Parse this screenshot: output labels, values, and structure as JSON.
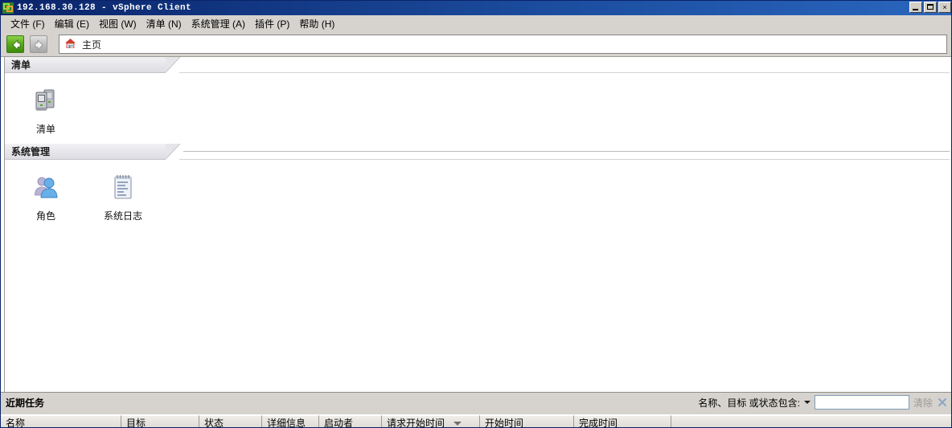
{
  "window": {
    "title": "192.168.30.128 - vSphere Client",
    "app_icon": "vsphere-app-icon",
    "minimize_label": "",
    "maximize_label": "",
    "close_label": "×"
  },
  "menubar": {
    "items": [
      {
        "label": "文件 (F)",
        "name": "menu-file"
      },
      {
        "label": "编辑 (E)",
        "name": "menu-edit"
      },
      {
        "label": "视图 (W)",
        "name": "menu-view"
      },
      {
        "label": "清单 (N)",
        "name": "menu-inventory"
      },
      {
        "label": "系统管理 (A)",
        "name": "menu-administration"
      },
      {
        "label": "插件 (P)",
        "name": "menu-plugins"
      },
      {
        "label": "帮助 (H)",
        "name": "menu-help"
      }
    ]
  },
  "navbar": {
    "back_icon": "back-arrow-icon",
    "forward_icon": "forward-arrow-icon",
    "home_icon": "home-icon",
    "breadcrumb": "主页"
  },
  "sections": [
    {
      "title": "清单",
      "name": "section-inventory",
      "tiles": [
        {
          "label": "清单",
          "icon": "servers-icon",
          "name": "tile-inventory"
        }
      ]
    },
    {
      "title": "系统管理",
      "name": "section-administration",
      "tiles": [
        {
          "label": "角色",
          "icon": "users-icon",
          "name": "tile-roles"
        },
        {
          "label": "系统日志",
          "icon": "notepad-icon",
          "name": "tile-system-logs"
        }
      ]
    }
  ],
  "tasks": {
    "title": "近期任务",
    "filter_label": "名称、目标 或状态包含:",
    "filter_value": "",
    "filter_placeholder": "",
    "clear_label": "清除",
    "close_icon": "close-x-icon",
    "columns": [
      {
        "label": "名称",
        "width": 150,
        "sorted": false
      },
      {
        "label": "目标",
        "width": 97,
        "sorted": false
      },
      {
        "label": "状态",
        "width": 78,
        "sorted": false
      },
      {
        "label": "详细信息",
        "width": 71,
        "sorted": false
      },
      {
        "label": "启动者",
        "width": 78,
        "sorted": false
      },
      {
        "label": "请求开始时间",
        "width": 122,
        "sorted": true
      },
      {
        "label": "开始时间",
        "width": 117,
        "sorted": false
      },
      {
        "label": "完成时间",
        "width": 121,
        "sorted": false
      }
    ],
    "rows": []
  },
  "colors": {
    "titlebar_start": "#0a246a",
    "titlebar_end": "#2a66be",
    "chrome": "#d6d3ce",
    "content_bg": "#ffffff",
    "back_arrow_green": "#57a81a",
    "home_roof_red": "#cf3f32",
    "close_x_blue": "#8fa8c4"
  }
}
